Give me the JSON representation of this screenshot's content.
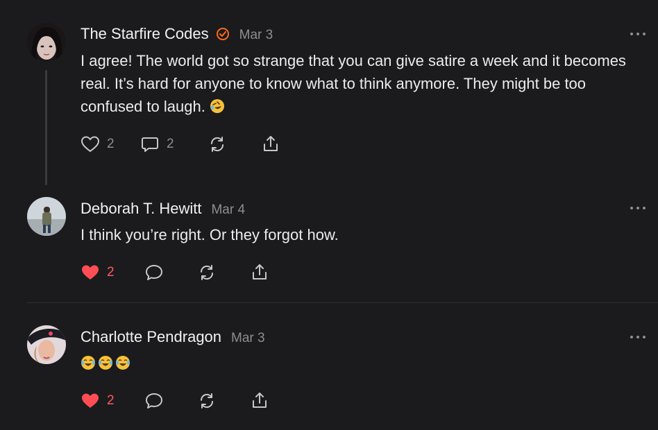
{
  "comments": [
    {
      "author": "The Starfire Codes",
      "date": "Mar 3",
      "verified": true,
      "text": "I agree! The world got so strange that you can give satire a week and it becomes real. It’s hard for anyone to know what to think anymore. They might be too confused to laugh.",
      "text_emoji": "rolling-on-the-floor-laughing",
      "likes": "2",
      "liked": false,
      "replies": "2"
    },
    {
      "author": "Deborah T. Hewitt",
      "date": "Mar 4",
      "text": "I think you’re right. Or they forgot how.",
      "likes": "2",
      "liked": true,
      "replies": ""
    },
    {
      "author": "Charlotte Pendragon",
      "date": "Mar 3",
      "text": "",
      "text_emoji": "face-with-tears-of-joy x3",
      "likes": "2",
      "liked": true,
      "replies": ""
    }
  ],
  "icons": {
    "like": "heart-icon",
    "reply": "speech-bubble-icon",
    "restack": "repost-icon",
    "share": "share-icon",
    "more": "more-dots-icon",
    "verified": "verified-badge-icon"
  },
  "colors": {
    "background": "#1b1b1d",
    "liked": "#ff5a5f",
    "verified": "#ff6b1a",
    "muted": "#8e8e93"
  }
}
